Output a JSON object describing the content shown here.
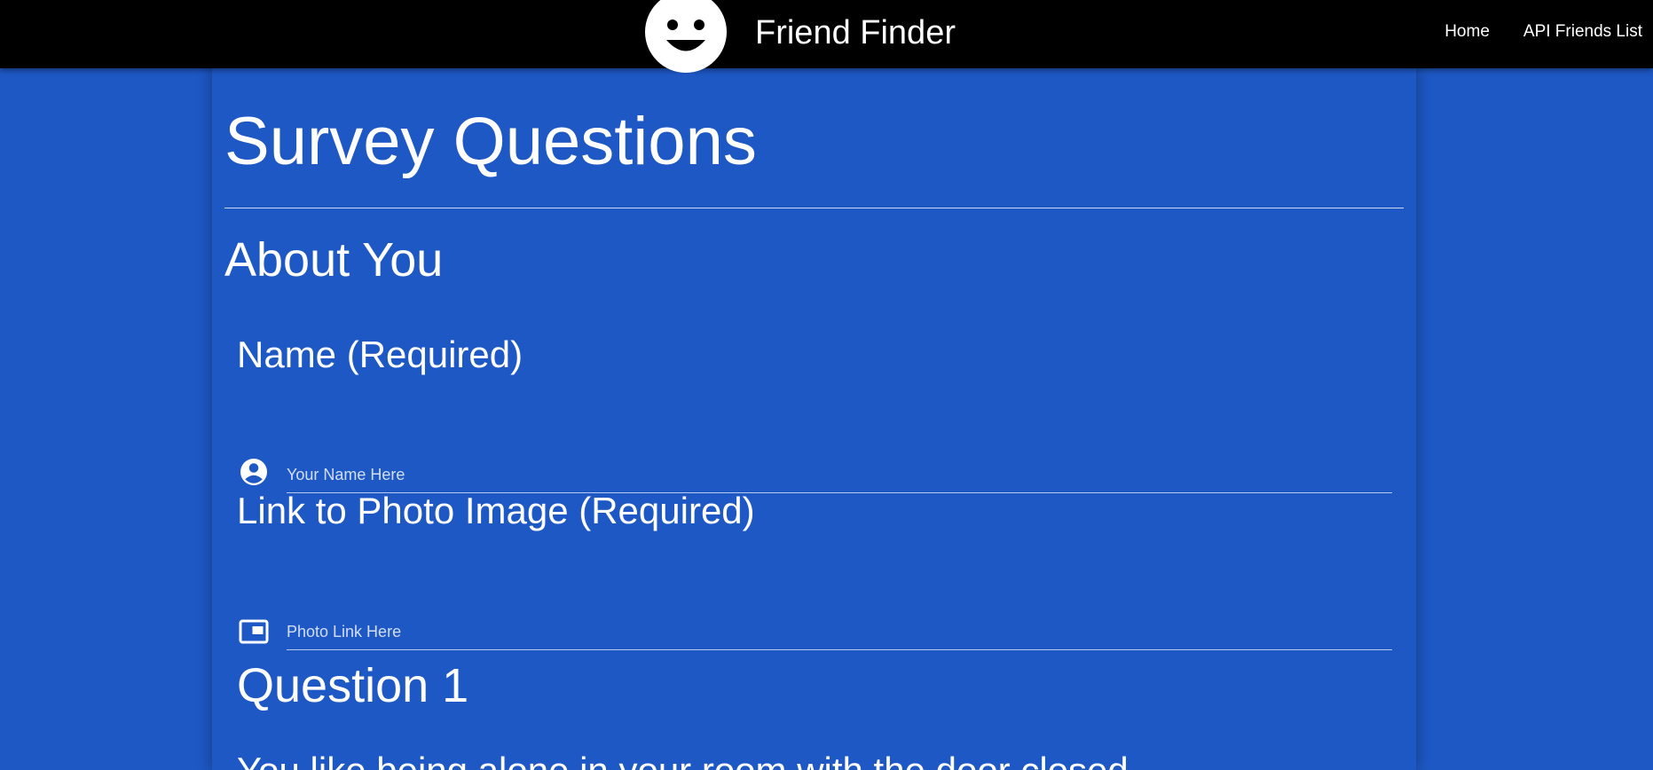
{
  "navbar": {
    "brand_title": "Friend Finder",
    "logo_icon": "smiley-face-icon",
    "links": [
      {
        "label": "Home"
      },
      {
        "label": "API Friends List"
      }
    ]
  },
  "page": {
    "title": "Survey Questions",
    "section_heading": "About You"
  },
  "fields": {
    "name": {
      "label": "Name (Required)",
      "icon": "account-circle-icon",
      "placeholder": "Your Name Here",
      "value": ""
    },
    "photo": {
      "label": "Link to Photo Image (Required)",
      "icon": "picture-in-picture-icon",
      "placeholder": "Photo Link Here",
      "value": ""
    }
  },
  "questions": [
    {
      "heading": "Question 1",
      "text": "You like being alone in your room with the door closed."
    }
  ],
  "colors": {
    "background": "#1e58c4",
    "navbar": "#000000",
    "text": "#ffffff"
  }
}
